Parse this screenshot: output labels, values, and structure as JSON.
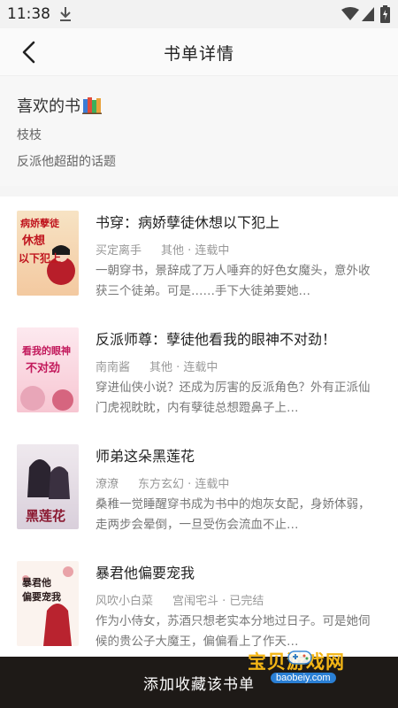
{
  "status_bar": {
    "time": "11:38"
  },
  "header": {
    "title": "书单详情"
  },
  "booklist": {
    "name": "喜欢的书",
    "author": "枝枝",
    "description": "反派他超甜的话题"
  },
  "books": [
    {
      "title": "书穿：病娇孽徒休想以下犯上",
      "author": "买定离手",
      "category": "其他 · 连载中",
      "description": "一朝穿书，景辞成了万人唾弃的好色女魔头，意外收获三个徒弟。可是……手下大徒弟要她…",
      "cover_text": "病娇孽徒休想以下犯上"
    },
    {
      "title": "反派师尊：孽徒他看我的眼神不对劲！",
      "author": "南南酱",
      "category": "其他 · 连载中",
      "description": "穿进仙侠小说？还成为厉害的反派角色？外有正派仙门虎视眈眈，内有孽徒总想蹬鼻子上…",
      "cover_text": "看我的眼神不对劲"
    },
    {
      "title": "师弟这朵黑莲花",
      "author": "潦潦",
      "category": "东方玄幻 · 连载中",
      "description": "桑稚一觉睡醒穿书成为书中的炮灰女配，身娇体弱，走两步会晕倒，一旦受伤会流血不止…",
      "cover_text": "黑莲花"
    },
    {
      "title": "暴君他偏要宠我",
      "author": "风吹小白菜",
      "category": "宫闱宅斗 · 已完结",
      "description": "作为小侍女，苏酒只想老实本分地过日子。可是她伺候的贵公子大魔王，偏偏看上了作天…",
      "cover_text": "暴君他偏要宠我"
    }
  ],
  "bottom_bar": {
    "label": "添加收藏该书单"
  },
  "watermark": {
    "title": "宝贝游戏网",
    "url": "baobeiy.com"
  },
  "colors": {
    "bottom_bar_bg": "#1e1a17",
    "watermark_gold": "#f3b515",
    "watermark_blue": "#2a7fd4"
  },
  "icons": [
    "download-icon",
    "wifi-icon",
    "signal-icon",
    "battery-icon",
    "back-arrow-icon",
    "books-icon",
    "gamepad-icon"
  ]
}
